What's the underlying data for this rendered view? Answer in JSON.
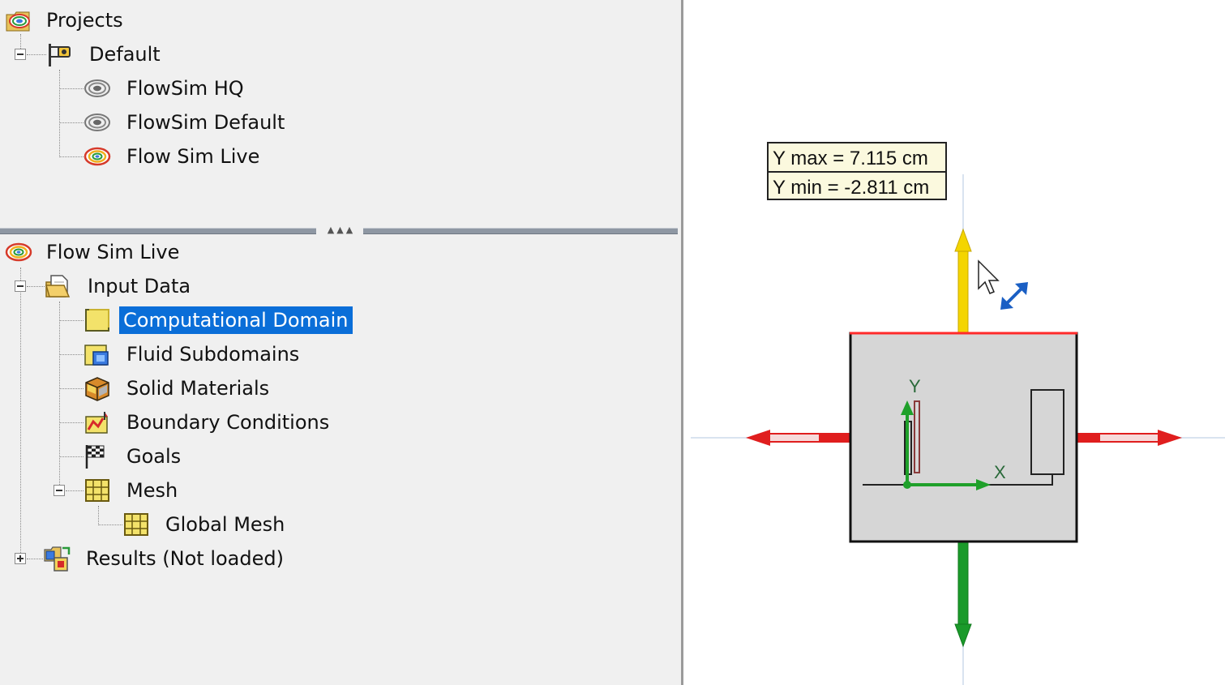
{
  "projects_tree": {
    "root": {
      "label": "Projects",
      "icon": "projects-icon"
    },
    "group": {
      "label": "Default",
      "icon": "configuration-icon"
    },
    "items": [
      {
        "label": "FlowSim HQ",
        "icon": "project-gray-icon"
      },
      {
        "label": "FlowSim Default",
        "icon": "project-gray-icon"
      },
      {
        "label": "Flow Sim Live",
        "icon": "project-color-icon"
      }
    ]
  },
  "analysis_tree": {
    "root": {
      "label": "Flow Sim Live",
      "icon": "project-color-icon"
    },
    "input_data": {
      "label": "Input Data",
      "icon": "input-data-icon"
    },
    "items": [
      {
        "label": "Computational Domain",
        "icon": "computational-domain-icon",
        "selected": true
      },
      {
        "label": "Fluid Subdomains",
        "icon": "fluid-subdomains-icon"
      },
      {
        "label": "Solid Materials",
        "icon": "solid-materials-icon"
      },
      {
        "label": "Boundary Conditions",
        "icon": "boundary-conditions-icon"
      },
      {
        "label": "Goals",
        "icon": "goals-icon"
      },
      {
        "label": "Mesh",
        "icon": "mesh-icon"
      }
    ],
    "mesh_children": [
      {
        "label": "Global Mesh",
        "icon": "mesh-icon"
      }
    ],
    "results": {
      "label": "Results (Not loaded)",
      "icon": "results-icon"
    }
  },
  "viewport": {
    "tooltip": {
      "ymax": "Y max = 7.115 cm",
      "ymin": "Y min = -2.811 cm"
    },
    "axis_labels": {
      "y": "Y",
      "x": "X"
    },
    "colors": {
      "up_arrow": "#f4d500",
      "down_arrow": "#1a9a2a",
      "side_arrows": "#e01e1e",
      "domain_fill": "#d6d6d6",
      "selected_edge": "#ff2a2a",
      "selection": "#0a6ed8"
    }
  }
}
